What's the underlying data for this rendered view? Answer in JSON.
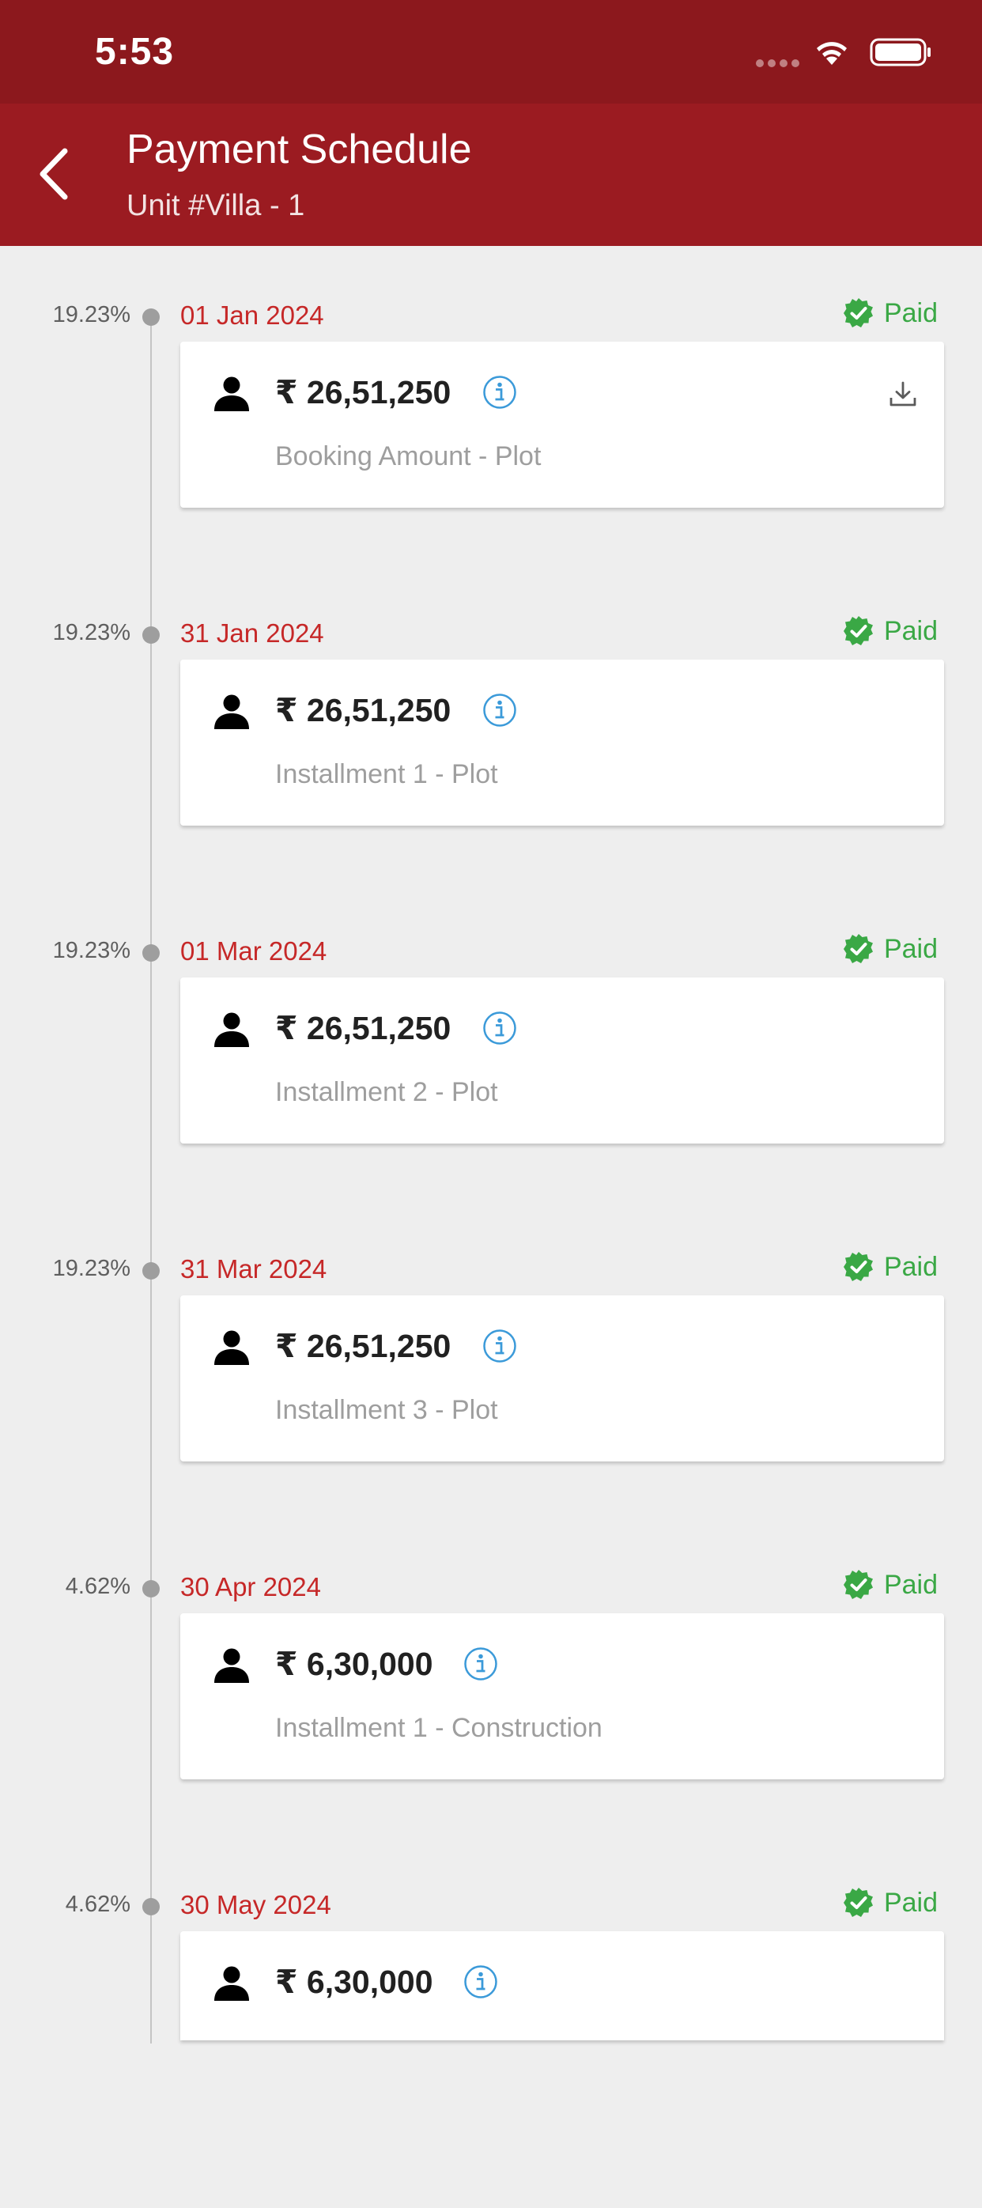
{
  "status_bar": {
    "time": "5:53"
  },
  "header": {
    "title": "Payment Schedule",
    "subtitle": "Unit #Villa - 1"
  },
  "colors": {
    "header": "#9b1b21",
    "status_bar": "#8c181d",
    "date": "#c62828",
    "paid": "#3aa845",
    "info": "#3b9ad9"
  },
  "schedule": [
    {
      "percent": "19.23%",
      "date": "01 Jan 2024",
      "status": "Paid",
      "amount": "₹ 26,51,250",
      "description": "Booking Amount - Plot"
    },
    {
      "percent": "19.23%",
      "date": "31 Jan 2024",
      "status": "Paid",
      "amount": "₹ 26,51,250",
      "description": "Installment 1 - Plot"
    },
    {
      "percent": "19.23%",
      "date": "01 Mar 2024",
      "status": "Paid",
      "amount": "₹ 26,51,250",
      "description": "Installment 2 - Plot"
    },
    {
      "percent": "19.23%",
      "date": "31 Mar 2024",
      "status": "Paid",
      "amount": "₹ 26,51,250",
      "description": "Installment 3 - Plot"
    },
    {
      "percent": "4.62%",
      "date": "30 Apr 2024",
      "status": "Paid",
      "amount": "₹ 6,30,000",
      "description": "Installment 1 - Construction"
    },
    {
      "percent": "4.62%",
      "date": "30 May 2024",
      "status": "Paid",
      "amount": "₹ 6,30,000",
      "description": ""
    }
  ]
}
